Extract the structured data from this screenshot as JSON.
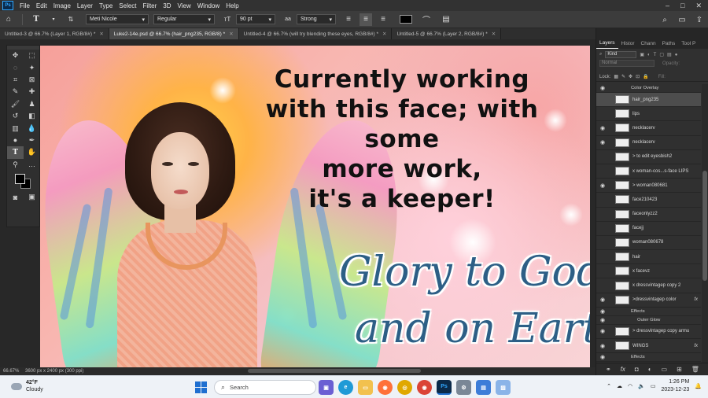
{
  "menu": [
    "File",
    "Edit",
    "Image",
    "Layer",
    "Type",
    "Select",
    "Filter",
    "3D",
    "View",
    "Window",
    "Help"
  ],
  "options": {
    "font_family": "Meti Nicole",
    "font_style": "Regular",
    "font_size": "90 pt",
    "antialias": "Strong",
    "text_color": "#000000"
  },
  "tabs": [
    {
      "label": "Untitled-3 @ 66.7% (Layer 1, RGB/8#) *",
      "active": false
    },
    {
      "label": "Luke2-14e.psd @ 66.7% (hair_png235, RGB/8) *",
      "active": true
    },
    {
      "label": "Untitled-4 @ 66.7% (will try blending these eyes, RGB/8#) *",
      "active": false
    },
    {
      "label": "Untitled-5 @ 66.7% (Layer 2, RGB/8#) *",
      "active": false
    }
  ],
  "canvas": {
    "headline": [
      "Currently working",
      "with this face; with some",
      "more work,",
      "it's a keeper!"
    ],
    "script_line1": "Glory to God in",
    "script_line2": "and on Earth"
  },
  "status": {
    "zoom": "66.67%",
    "doc_info": "3600 px x 2400 px (300 ppi)"
  },
  "panel": {
    "tabs": [
      "Layers",
      "Histor",
      "Chann",
      "Paths",
      "Tool P"
    ],
    "filter_kind": "Kind",
    "blend_mode": "Normal",
    "opacity_label": "Opacity:",
    "lock_label": "Lock:",
    "fill_label": "Fill:",
    "layers": [
      {
        "name": "Color Overlay",
        "type": "effect",
        "visible": true
      },
      {
        "name": "hair_png235",
        "type": "layer",
        "visible": false,
        "selected": true
      },
      {
        "name": "lips",
        "type": "layer",
        "visible": false
      },
      {
        "name": "necklacerv",
        "type": "layer",
        "visible": true
      },
      {
        "name": "necklacerv",
        "type": "layer",
        "visible": true
      },
      {
        "name": "> to edit eyesbish2",
        "type": "layer",
        "visible": false
      },
      {
        "name": "x woman-cos...s-face LIPS",
        "type": "layer",
        "visible": false
      },
      {
        "name": "> woman080681",
        "type": "layer",
        "visible": true
      },
      {
        "name": "face210423",
        "type": "layer",
        "visible": false
      },
      {
        "name": "faceonlyzz2",
        "type": "layer",
        "visible": false
      },
      {
        "name": "facejj",
        "type": "layer",
        "visible": false
      },
      {
        "name": "woman080678",
        "type": "layer",
        "visible": false
      },
      {
        "name": "hair",
        "type": "layer",
        "visible": false
      },
      {
        "name": "x facevz",
        "type": "layer",
        "visible": false
      },
      {
        "name": "x dressvintagep copy 2",
        "type": "layer",
        "visible": false
      },
      {
        "name": ">dressvintagep color",
        "type": "layer",
        "visible": true,
        "fx": true
      },
      {
        "name": "Effects",
        "type": "effect",
        "visible": true
      },
      {
        "name": "Outer Glow",
        "type": "effect2",
        "visible": true
      },
      {
        "name": "> dressvintagep copy armu",
        "type": "layer",
        "visible": true
      },
      {
        "name": "WINGS",
        "type": "layer",
        "visible": true,
        "fx": true
      },
      {
        "name": "Effects",
        "type": "effect",
        "visible": true
      }
    ]
  },
  "taskbar": {
    "temp": "42°F",
    "weather": "Cloudy",
    "search_placeholder": "Search",
    "time": "1:26 PM",
    "date": "2023-12-23"
  }
}
